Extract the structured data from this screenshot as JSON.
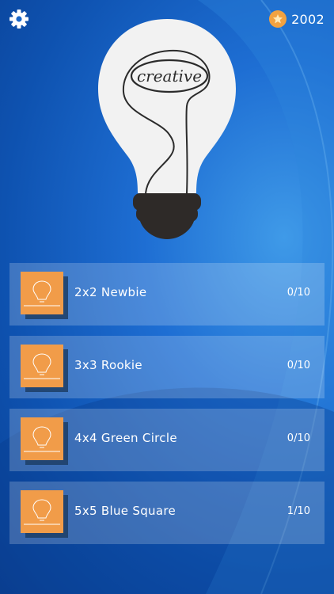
{
  "header": {
    "settings_icon": "gear-icon",
    "coin_icon": "star-coin-icon",
    "coins": "2002"
  },
  "hero": {
    "bulb_word": "creative"
  },
  "levels": [
    {
      "name": "2x2 Newbie",
      "progress": "0/10"
    },
    {
      "name": "3x3 Rookie",
      "progress": "0/10"
    },
    {
      "name": "4x4 Green Circle",
      "progress": "0/10"
    },
    {
      "name": "5x5 Blue Square",
      "progress": "1/10"
    }
  ],
  "colors": {
    "background": "#1660c4",
    "accent_orange": "#f19c49",
    "coin": "#f2a241",
    "bulb_glass": "#f2f2f2",
    "bulb_base": "#2e2a28"
  }
}
